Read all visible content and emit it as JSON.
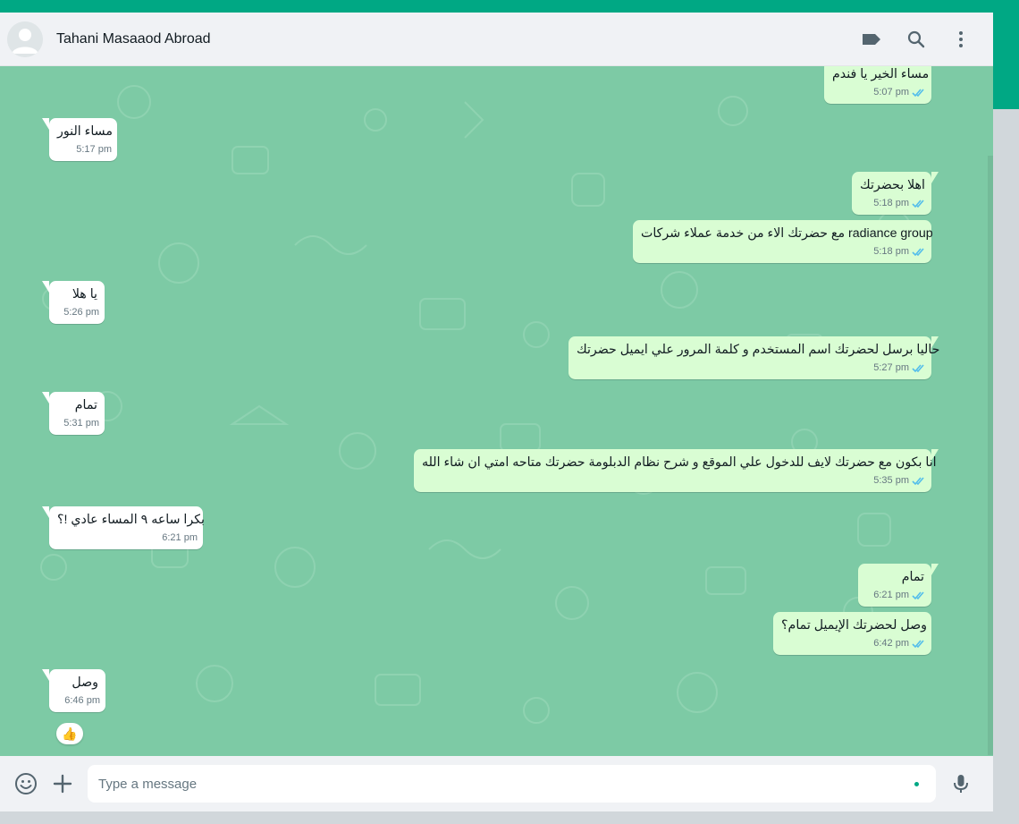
{
  "colors": {
    "accent": "#00a884",
    "chat_background": "#7dcaa5",
    "incoming_bubble": "#ffffff",
    "outgoing_bubble": "#d9fdd3",
    "read_tick": "#53bdeb"
  },
  "header": {
    "contact_name": "Tahani Masaaod Abroad",
    "icons": [
      "label-icon",
      "search-icon",
      "menu-dots-icon"
    ]
  },
  "messages": [
    {
      "direction": "out",
      "text": "مساء الخير يا فندم",
      "time": "5:07 pm",
      "status": "read"
    },
    {
      "direction": "in",
      "text": "مساء النور",
      "time": "5:17 pm"
    },
    {
      "direction": "out",
      "text": "اهلا بحضرتك",
      "time": "5:18 pm",
      "status": "read"
    },
    {
      "direction": "out",
      "text": "مع حضرتك الاء من خدمة عملاء شركات radiance group",
      "time": "5:18 pm",
      "status": "read"
    },
    {
      "direction": "in",
      "text": "يا هلا",
      "time": "5:26 pm"
    },
    {
      "direction": "out",
      "text": "حاليا برسل لحضرتك اسم المستخدم و كلمة المرور علي ايميل حضرتك",
      "time": "5:27 pm",
      "status": "read"
    },
    {
      "direction": "in",
      "text": "تمام",
      "time": "5:31 pm"
    },
    {
      "direction": "out",
      "text": "انا بكون مع حضرتك لايف للدخول علي الموقع و شرح نظام الدبلومة حضرتك متاحه امتي ان شاء الله",
      "time": "5:35 pm",
      "status": "read"
    },
    {
      "direction": "in",
      "text": "بكرا ساعه ٩ المساء عادي !؟",
      "time": "6:21 pm"
    },
    {
      "direction": "out",
      "text": "تمام",
      "time": "6:21 pm",
      "status": "read"
    },
    {
      "direction": "out",
      "text": "وصل لحضرتك الإيميل تمام؟",
      "time": "6:42 pm",
      "status": "read"
    },
    {
      "direction": "in",
      "text": "وصل",
      "time": "6:46 pm",
      "reaction": "👍"
    }
  ],
  "composer": {
    "placeholder": "Type a message",
    "icons": [
      "emoji-icon",
      "attach-plus-icon",
      "microphone-icon"
    ]
  }
}
